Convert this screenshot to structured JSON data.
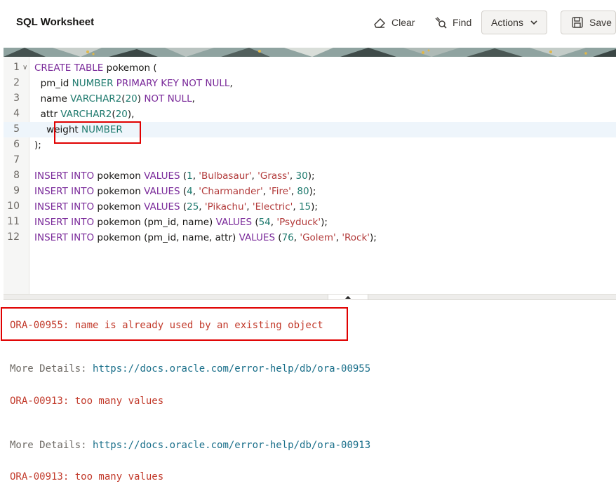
{
  "header": {
    "title": "SQL Worksheet",
    "clear_label": "Clear",
    "find_label": "Find",
    "actions_label": "Actions",
    "save_label": "Save"
  },
  "editor": {
    "active_line": 5,
    "line_numbers": [
      "1",
      "2",
      "3",
      "4",
      "5",
      "6",
      "7",
      "8",
      "9",
      "10",
      "11",
      "12"
    ]
  },
  "output": {
    "error1": "ORA-00955: name is already used by an existing object",
    "details_label_1": "More Details: ",
    "details_url_1": "https://docs.oracle.com/error-help/db/ora-00955",
    "error2": "ORA-00913: too many values",
    "details_label_2": "More Details: ",
    "details_url_2": "https://docs.oracle.com/error-help/db/ora-00913",
    "error3": "ORA-00913: too many values"
  },
  "colors": {
    "keyword": "#7a2a9a",
    "type": "#1f7a6e",
    "string": "#b23a3a",
    "error": "#c23a2b",
    "link": "#1a6f8a",
    "highlight_border": "#e00000"
  },
  "icons": [
    "eraser-icon",
    "find-icon",
    "chevron-down-icon",
    "save-disk-icon",
    "fold-chevron-icon",
    "splitter-grip-icon"
  ]
}
